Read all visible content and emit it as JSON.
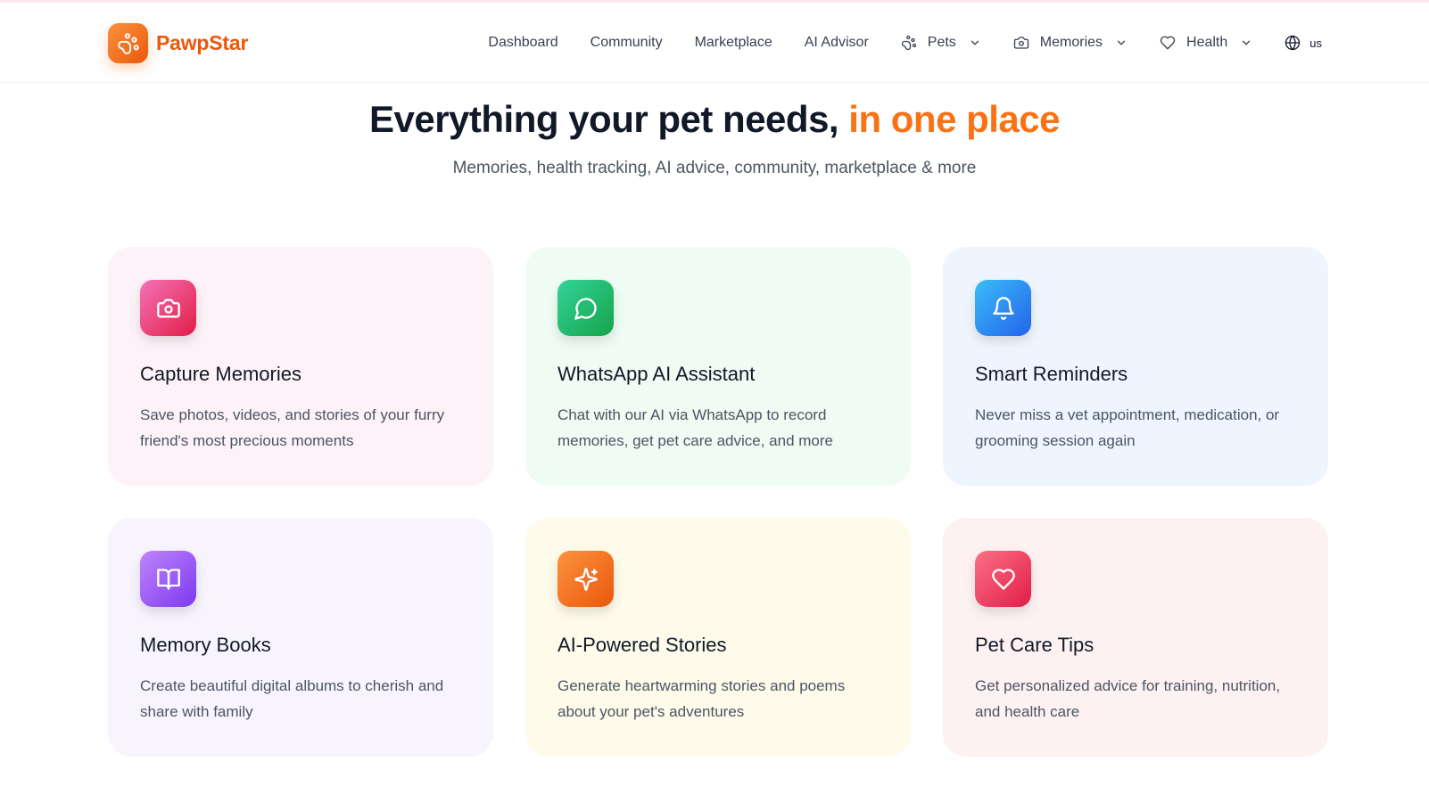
{
  "brand": {
    "name": "PawpStar",
    "logo_icon": "paw-icon",
    "color": "#ea580c"
  },
  "nav": {
    "dashboard": "Dashboard",
    "community": "Community",
    "marketplace": "Marketplace",
    "ai_advisor": "AI Advisor",
    "pets": "Pets",
    "memories": "Memories",
    "health": "Health",
    "language": "us"
  },
  "hero": {
    "title_main": "Everything your pet needs, ",
    "title_accent": "in one place",
    "accent_color": "#f97316",
    "subtitle": "Memories, health tracking, AI advice, community, marketplace & more"
  },
  "features": [
    {
      "title": "Capture Memories",
      "description": "Save photos, videos, and stories of your furry friend's most precious moments",
      "icon": "camera-icon",
      "icon_color": "#ec4899",
      "bg_color": "#fdf2f8"
    },
    {
      "title": "WhatsApp AI Assistant",
      "description": "Chat with our AI via WhatsApp to record memories, get pet care advice, and more",
      "icon": "chat-bubble-icon",
      "icon_color": "#22c55e",
      "bg_color": "#effcf4"
    },
    {
      "title": "Smart Reminders",
      "description": "Never miss a vet appointment, medication, or grooming session again",
      "icon": "bell-icon",
      "icon_color": "#0ea5e9",
      "bg_color": "#eef5fe"
    },
    {
      "title": "Memory Books",
      "description": "Create beautiful digital albums to cherish and share with family",
      "icon": "book-open-icon",
      "icon_color": "#a855f7",
      "bg_color": "#f8f4fe"
    },
    {
      "title": "AI-Powered Stories",
      "description": "Generate heartwarming stories and poems about your pet's adventures",
      "icon": "sparkles-icon",
      "icon_color": "#f97316",
      "bg_color": "#fefbea"
    },
    {
      "title": "Pet Care Tips",
      "description": "Get personalized advice for training, nutrition, and health care",
      "icon": "heart-icon",
      "icon_color": "#f43f5e",
      "bg_color": "#fdf1f2"
    }
  ]
}
